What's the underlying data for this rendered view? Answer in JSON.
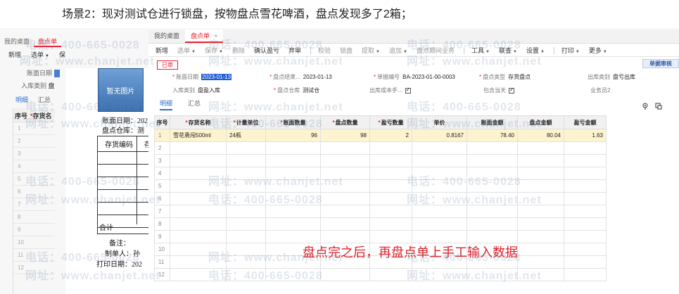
{
  "scene_title": "场景2：现对测试仓进行锁盘，按物盘点雪花啤酒，盘点发现多了2箱；",
  "watermarks": [
    "电话：400-665-0028",
    "网址：www.chanjet.net",
    "电话：400-665-0028",
    "网址：www.chanjet.net",
    "电话：400-665-0028",
    "网址：www.chanjet.net",
    "电话：400-665-0028",
    "网址：www.chanjet.net",
    "电话：400-665-0028",
    "网址：www.chanjet.net",
    "电话：400-665-0028",
    "网址：www.chanjet.net",
    "电话：400-665-0028",
    "网址：www.chanjet.net",
    "电话：400-665-0028",
    "网址：www.chanjet.net",
    "电话：400-665-0028",
    "网址：www.chanjet.net",
    "电话：400-665-0028",
    "网址：www.chanjet.net",
    "电话：400-665-0028",
    "网址：www.chanjet.net",
    "电话：400-665-0028",
    "网址：www.chanjet.net"
  ],
  "background_window": {
    "tabs": [
      "我的桌面",
      "盘点单"
    ],
    "toolbar": [
      "新增",
      "选单",
      "保"
    ],
    "fields": {
      "date_label": "账面日期",
      "date_value": "2",
      "type_label": "入库类别",
      "type_value": "盘"
    },
    "subtabs": [
      "明细",
      "汇总"
    ],
    "grid_headers": [
      "序号",
      "存货名"
    ],
    "row_numbers": [
      "1",
      "2",
      "3",
      "4",
      "5",
      "6",
      "7",
      "8",
      "9",
      "10",
      "11",
      "12"
    ]
  },
  "print_preview": {
    "no_image_label": "暂无图片",
    "date_line": "账面日期：202",
    "warehouse_line": "盘点仓库：测",
    "table_header_col1": "存货编码",
    "table_header_col2": "存",
    "table_total": "合计",
    "remark_line": "备注：",
    "maker_line": "制单人：孙",
    "print_date_line": "打印日期：202"
  },
  "front_window": {
    "tabs": [
      {
        "label": "我的桌面",
        "active": false
      },
      {
        "label": "盘点单",
        "active": true,
        "close": "×"
      }
    ],
    "toolbar": [
      {
        "label": "新增",
        "caret": false,
        "disabled": false
      },
      {
        "label": "选单",
        "caret": true,
        "disabled": true
      },
      {
        "label": "保存",
        "caret": true,
        "disabled": true
      },
      {
        "label": "删除",
        "caret": false,
        "disabled": true
      },
      {
        "label": "确认盈亏",
        "caret": false,
        "disabled": false
      },
      {
        "label": "弃审",
        "caret": false,
        "disabled": false
      },
      {
        "label": "校验",
        "caret": false,
        "disabled": true
      },
      {
        "label": "锁盘",
        "caret": false,
        "disabled": true
      },
      {
        "label": "提取",
        "caret": true,
        "disabled": true
      },
      {
        "label": "追加",
        "caret": true,
        "disabled": true
      },
      {
        "label": "盘点期间业务",
        "caret": false,
        "disabled": true
      },
      {
        "label": "工具",
        "caret": true,
        "disabled": false
      },
      {
        "label": "联查",
        "caret": true,
        "disabled": false
      },
      {
        "label": "设置",
        "caret": true,
        "disabled": false
      },
      {
        "label": "打印",
        "caret": true,
        "disabled": false
      },
      {
        "label": "更多",
        "caret": true,
        "disabled": false
      }
    ],
    "status_tag": "已审",
    "audit_button": "单据审核",
    "header_fields": {
      "book_date_label": "账面日期",
      "book_date_value": "2023-01-13",
      "end_date_label": "盘点结束...",
      "end_date_value": "2023-01-13",
      "doc_no_label": "单据编号",
      "doc_no_value": "BA-2023-01-00-0003",
      "count_type_label": "盘点类型",
      "count_type_value": "存货盘点",
      "out_type_label": "出库类别",
      "out_type_value": "盘亏出库",
      "in_type_label": "入库类别",
      "in_type_value": "盘盈入库",
      "warehouse_label": "盘点仓库",
      "warehouse_value": "测试仓",
      "out_cost_label": "出库成本手...",
      "include_day_label": "包含当天",
      "salesman_label": "业务员2"
    },
    "subtabs": [
      "明细",
      "汇总"
    ],
    "grid": {
      "headers": [
        {
          "label": "序号",
          "req": false
        },
        {
          "label": "存货名称",
          "req": true
        },
        {
          "label": "计量单位",
          "req": true
        },
        {
          "label": "账面数量",
          "req": true
        },
        {
          "label": "盘点数量",
          "req": true
        },
        {
          "label": "盈亏数量",
          "req": true
        },
        {
          "label": "单价",
          "req": false
        },
        {
          "label": "账面金额",
          "req": false
        },
        {
          "label": "盘点金额",
          "req": false
        },
        {
          "label": "盈亏金额",
          "req": false
        }
      ],
      "rows": [
        [
          "1",
          "雪花勇闯500ml",
          "24瓶",
          "96",
          "98",
          "2",
          "0.8167",
          "78.40",
          "80.04",
          "1.63"
        ],
        [
          "2",
          "",
          "",
          "",
          "",
          "",
          "",
          "",
          "",
          ""
        ],
        [
          "3",
          "",
          "",
          "",
          "",
          "",
          "",
          "",
          "",
          ""
        ],
        [
          "4",
          "",
          "",
          "",
          "",
          "",
          "",
          "",
          "",
          ""
        ],
        [
          "5",
          "",
          "",
          "",
          "",
          "",
          "",
          "",
          "",
          ""
        ],
        [
          "6",
          "",
          "",
          "",
          "",
          "",
          "",
          "",
          "",
          ""
        ],
        [
          "7",
          "",
          "",
          "",
          "",
          "",
          "",
          "",
          "",
          ""
        ],
        [
          "8",
          "",
          "",
          "",
          "",
          "",
          "",
          "",
          "",
          ""
        ],
        [
          "9",
          "",
          "",
          "",
          "",
          "",
          "",
          "",
          "",
          ""
        ],
        [
          "10",
          "",
          "",
          "",
          "",
          "",
          "",
          "",
          "",
          ""
        ],
        [
          "11",
          "",
          "",
          "",
          "",
          "",
          "",
          "",
          "",
          ""
        ],
        [
          "12",
          "",
          "",
          "",
          "",
          "",
          "",
          "",
          "",
          ""
        ]
      ]
    }
  },
  "annotation": "盘点完之后，再盘点单上手工输入数据",
  "colors": {
    "accent_red": "#e23",
    "link_blue": "#2d6fd1",
    "highlight_row": "#fcf3cf",
    "annotation_red": "#e0202a"
  },
  "icons": [
    "location-pin-icon",
    "layout-toggle-icon"
  ]
}
